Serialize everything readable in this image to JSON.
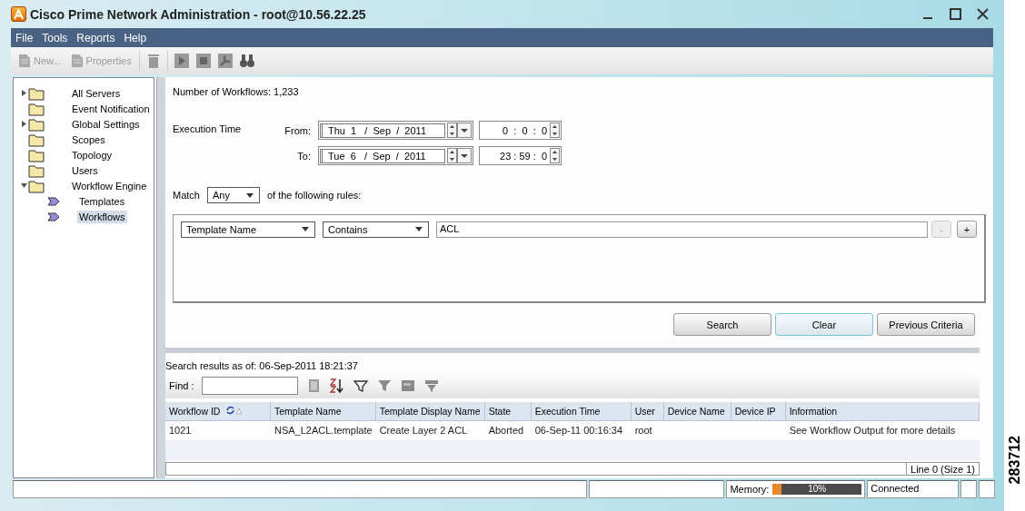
{
  "window": {
    "title": "Cisco Prime Network Administration - root@10.56.22.25"
  },
  "menu": [
    "File",
    "Tools",
    "Reports",
    "Help"
  ],
  "toolbar": [
    {
      "label": "New...",
      "disabled": true
    },
    {
      "label": "Properties",
      "disabled": true
    }
  ],
  "tree": [
    {
      "label": "All Servers",
      "expanded": false,
      "selected": false
    },
    {
      "label": "Event Notification",
      "selected": false
    },
    {
      "label": "Global Settings",
      "expanded": false,
      "selected": false
    },
    {
      "label": "Scopes",
      "selected": false
    },
    {
      "label": "Topology",
      "selected": false
    },
    {
      "label": "Users",
      "selected": false
    },
    {
      "label": "Workflow Engine",
      "expanded": true,
      "selected": false,
      "children": [
        {
          "label": "Templates",
          "selected": false
        },
        {
          "label": "Workflows",
          "selected": true
        }
      ]
    }
  ],
  "workflow_count": "Number of Workflows: 1,233",
  "execution_time": {
    "label": "Execution Time",
    "from": {
      "label": "From:",
      "date": "Thu  1   /  Sep  /  2011",
      "time": "0  :  0  :  0"
    },
    "to": {
      "label": "To:",
      "date": "Tue  6   /  Sep  /  2011",
      "time": "23 : 59 :  0"
    }
  },
  "match": {
    "label": "Match",
    "value": "Any",
    "suffix": "of the following rules:"
  },
  "rules": [
    {
      "field": "Template Name",
      "operator": "Contains",
      "value": "ACL"
    }
  ],
  "rule_buttons": [
    {
      "label": "-",
      "disabled": true
    },
    {
      "label": "+",
      "disabled": false
    }
  ],
  "actions": [
    {
      "label": "Search",
      "focused": false
    },
    {
      "label": "Clear",
      "focused": true
    },
    {
      "label": "Previous Criteria",
      "focused": false
    }
  ],
  "results": {
    "timestamp": "Search results as of: 06-Sep-2011 18:21:37",
    "find_label": "Find :",
    "columns": [
      {
        "label": "Workflow ID",
        "sorted": true
      },
      {
        "label": "Template Name",
        "sorted": false
      },
      {
        "label": "Template Display Name",
        "sorted": false
      },
      {
        "label": "State",
        "sorted": false
      },
      {
        "label": "Execution Time",
        "sorted": false
      },
      {
        "label": "User",
        "sorted": false
      },
      {
        "label": "Device Name",
        "sorted": false
      },
      {
        "label": "Device IP",
        "sorted": false
      },
      {
        "label": "Information",
        "sorted": false
      }
    ],
    "rows": [
      [
        "1021",
        "NSA_L2ACL.template",
        "Create Layer 2 ACL",
        "Aborted",
        "06-Sep-11 00:16:34",
        "root",
        "",
        "",
        "See Workflow Output for more details"
      ]
    ],
    "footer": "Line 0 (Size 1)"
  },
  "status_bar": {
    "memory_label": "Memory:",
    "memory": {
      "level": 0.1,
      "reading": "10%"
    },
    "connection": "Connected"
  },
  "figure_number": "283712"
}
